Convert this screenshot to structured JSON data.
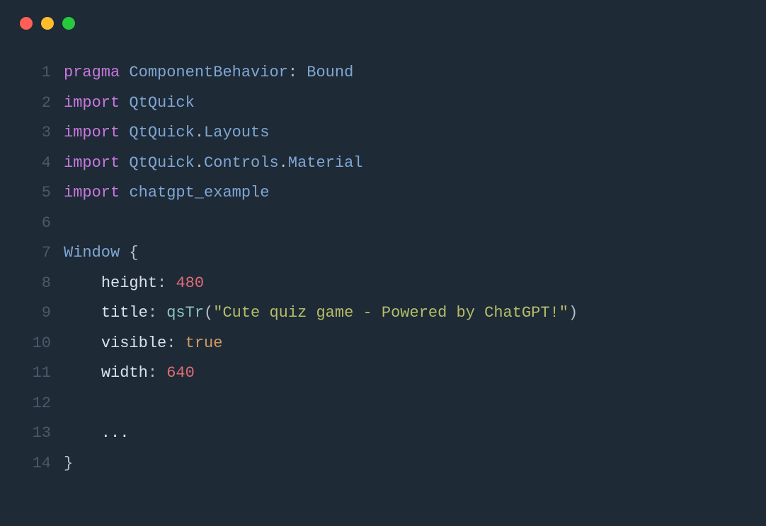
{
  "window": {
    "traffic": [
      "red",
      "yellow",
      "green"
    ]
  },
  "code": {
    "lines": [
      {
        "num": "1",
        "tokens": [
          [
            "pragma ",
            "c-keyword"
          ],
          [
            "ComponentBehavior",
            "c-type"
          ],
          [
            ": ",
            "c-punc"
          ],
          [
            "Bound",
            "c-type"
          ]
        ]
      },
      {
        "num": "2",
        "tokens": [
          [
            "import ",
            "c-keyword"
          ],
          [
            "QtQuick",
            "c-type"
          ]
        ]
      },
      {
        "num": "3",
        "tokens": [
          [
            "import ",
            "c-keyword"
          ],
          [
            "QtQuick",
            "c-type"
          ],
          [
            ".",
            "c-punc"
          ],
          [
            "Layouts",
            "c-type"
          ]
        ]
      },
      {
        "num": "4",
        "tokens": [
          [
            "import ",
            "c-keyword"
          ],
          [
            "QtQuick",
            "c-type"
          ],
          [
            ".",
            "c-punc"
          ],
          [
            "Controls",
            "c-type"
          ],
          [
            ".",
            "c-punc"
          ],
          [
            "Material",
            "c-type"
          ]
        ]
      },
      {
        "num": "5",
        "tokens": [
          [
            "import ",
            "c-keyword"
          ],
          [
            "chatgpt_example",
            "c-type"
          ]
        ]
      },
      {
        "num": "6",
        "tokens": [
          [
            "",
            "c-default"
          ]
        ]
      },
      {
        "num": "7",
        "tokens": [
          [
            "Window ",
            "c-type"
          ],
          [
            "{",
            "c-punc"
          ]
        ]
      },
      {
        "num": "8",
        "tokens": [
          [
            "    ",
            "c-default"
          ],
          [
            "height",
            "c-prop"
          ],
          [
            ": ",
            "c-punc"
          ],
          [
            "480",
            "c-number"
          ]
        ]
      },
      {
        "num": "9",
        "tokens": [
          [
            "    ",
            "c-default"
          ],
          [
            "title",
            "c-prop"
          ],
          [
            ": ",
            "c-punc"
          ],
          [
            "qsTr",
            "c-func"
          ],
          [
            "(",
            "c-punc"
          ],
          [
            "\"Cute quiz game - Powered by ChatGPT!\"",
            "c-string"
          ],
          [
            ")",
            "c-punc"
          ]
        ]
      },
      {
        "num": "10",
        "tokens": [
          [
            "    ",
            "c-default"
          ],
          [
            "visible",
            "c-prop"
          ],
          [
            ": ",
            "c-punc"
          ],
          [
            "true",
            "c-bool"
          ]
        ]
      },
      {
        "num": "11",
        "tokens": [
          [
            "    ",
            "c-default"
          ],
          [
            "width",
            "c-prop"
          ],
          [
            ": ",
            "c-punc"
          ],
          [
            "640",
            "c-number"
          ]
        ]
      },
      {
        "num": "12",
        "tokens": [
          [
            "",
            "c-default"
          ]
        ]
      },
      {
        "num": "13",
        "tokens": [
          [
            "    ...",
            "c-default"
          ]
        ]
      },
      {
        "num": "14",
        "tokens": [
          [
            "}",
            "c-punc"
          ]
        ]
      }
    ]
  }
}
